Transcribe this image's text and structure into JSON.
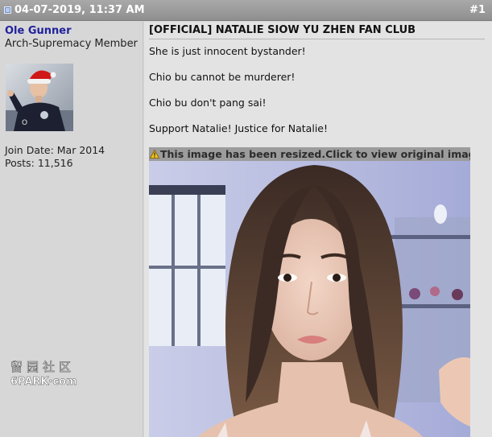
{
  "post": {
    "date": "04-07-2019, 11:37 AM",
    "number": "#1",
    "title": "[OFFICIAL] NATALIE SIOW YU ZHEN FAN CLUB",
    "lines": [
      "She is just innocent bystander!",
      "Chio bu cannot be murderer!",
      "Chio bu don't pang sai!",
      "Support Natalie! Justice for Natalie!"
    ],
    "resize_notice": "This image has been resized.Click to view original image"
  },
  "user": {
    "name": "Ole Gunner",
    "title": "Arch-Supremacy Member",
    "join_date": "Join Date: Mar 2014",
    "posts": "Posts: 11,516"
  },
  "watermark": {
    "line1": "留园社区",
    "line2": "6PARK·com"
  },
  "colors": {
    "header_bg": "#999999",
    "username": "#22229c",
    "content_bg": "#e3e3e3",
    "sidebar_bg": "#d7d7d7",
    "resize_bar": "#9c9c9c"
  },
  "icons": {
    "post": "post-status-icon",
    "warning": "warning-icon"
  }
}
